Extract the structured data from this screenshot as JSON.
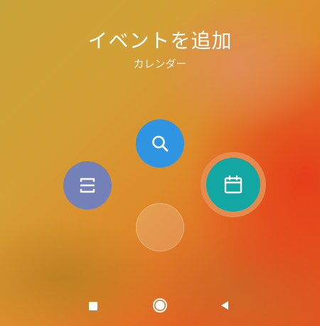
{
  "header": {
    "title": "イベントを追加",
    "subtitle": "カレンダー"
  },
  "actions": [
    {
      "id": "search",
      "icon": "search-icon",
      "color": "#2f95e2"
    },
    {
      "id": "scan",
      "icon": "scan-icon",
      "color": "#7480b8"
    },
    {
      "id": "calendar",
      "icon": "calendar-icon",
      "color": "#12a7a2",
      "selected": true
    }
  ],
  "navbar": {
    "icons": [
      "recent-apps-icon",
      "home-icon",
      "back-icon"
    ]
  }
}
